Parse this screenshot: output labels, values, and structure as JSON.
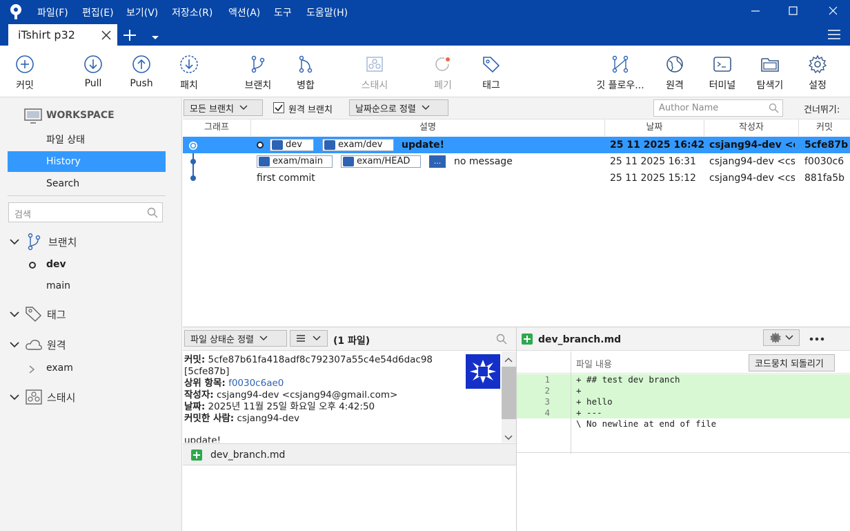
{
  "app": {
    "menu": [
      "파일(F)",
      "편집(E)",
      "보기(V)",
      "저장소(R)",
      "액션(A)",
      "도구",
      "도움말(H)"
    ],
    "tab_title": "iTshirt p32"
  },
  "toolbar": {
    "commit": "커밋",
    "pull": "Pull",
    "push": "Push",
    "patch": "패치",
    "branch": "브랜치",
    "merge": "병합",
    "stash": "스태시",
    "discard": "폐기",
    "tag": "태그",
    "gitflow": "깃 플로우...",
    "remote": "원격",
    "terminal": "터미널",
    "explorer": "탐색기",
    "settings": "설정"
  },
  "sidebar": {
    "workspace": "WORKSPACE",
    "file_status": "파일 상태",
    "history": "History",
    "search": "Search",
    "search_placeholder": "검색",
    "branches_label": "브랜치",
    "branches": [
      "dev",
      "main"
    ],
    "tags_label": "태그",
    "remotes_label": "원격",
    "remotes": [
      "exam"
    ],
    "stashes_label": "스태시"
  },
  "filter": {
    "all_branches": "모든 브랜치",
    "remote_branches": "원격 브랜치",
    "sort": "날짜순으로 정렬",
    "author_placeholder": "Author Name",
    "skip": "건너뛰기:"
  },
  "columns": {
    "graph": "그래프",
    "desc": "설명",
    "date": "날짜",
    "author": "작성자",
    "commit": "커밋"
  },
  "commits": [
    {
      "branches": [
        "dev",
        "exam/dev"
      ],
      "message": "update!",
      "date": "25 11 2025 16:42",
      "author": "csjang94-dev <cs",
      "hash": "5cfe87b",
      "selected": true
    },
    {
      "branches": [
        "exam/main",
        "exam/HEAD",
        "..."
      ],
      "message": "no message",
      "date": "25 11 2025 16:31",
      "author": "csjang94-dev <csj",
      "hash": "f0030c6",
      "selected": false
    },
    {
      "branches": [],
      "message": "first commit",
      "date": "25 11 2025 15:12",
      "author": "csjang94-dev <csj",
      "hash": "881fa5b",
      "selected": false
    }
  ],
  "details": {
    "sort_label": "파일 상태순 정렬",
    "file_count": "(1 파일)",
    "commit_label": "커밋:",
    "commit_full": "5cfe87b61fa418adf8c792307a55c4e54d6dac98",
    "commit_short": "[5cfe87b]",
    "parent_label": "상위 항목:",
    "parent": "f0030c6ae0",
    "author_label": "작성자:",
    "author": "csjang94-dev <csjang94@gmail.com>",
    "date_label": "날짜:",
    "date": "2025년 11월 25일 화요일 오후 4:42:50",
    "committer_label": "커밋한 사람:",
    "committer": "csjang94-dev",
    "message": "update!",
    "file": "dev_branch.md"
  },
  "diff": {
    "file": "dev_branch.md",
    "section": "파일 내용",
    "revert_button": "코드뭉치 되돌리기",
    "lines": [
      {
        "n": "1",
        "text": "+ ## test dev branch"
      },
      {
        "n": "2",
        "text": "+"
      },
      {
        "n": "3",
        "text": "+ hello"
      },
      {
        "n": "4",
        "text": "+ ---"
      },
      {
        "n": "",
        "text": "\\ No newline at end of file"
      }
    ]
  },
  "colors": {
    "accent": "#0746a6",
    "selected_row": "#3399ff",
    "added_line": "#d7f8d2",
    "file_added": "#2fa84f"
  }
}
